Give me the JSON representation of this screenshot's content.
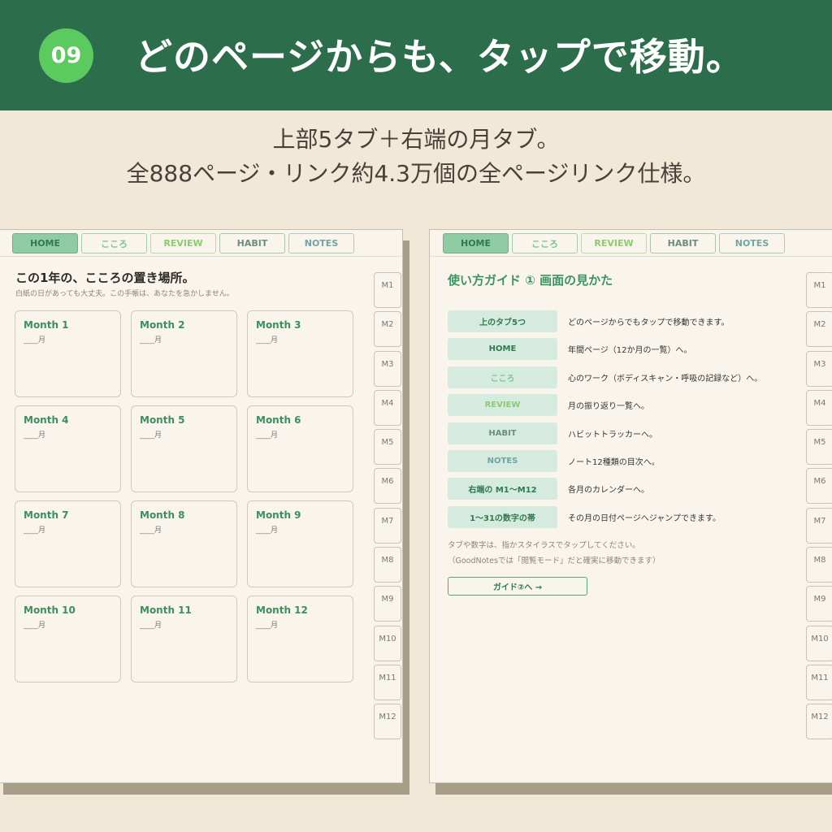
{
  "header": {
    "number": "09",
    "title": "どのページからも、タップで移動。"
  },
  "subtitle": {
    "line1": "上部5タブ＋右端の月タブ。",
    "line2": "全888ページ・リンク約4.3万個の全ページリンク仕様。"
  },
  "tabs": {
    "home": "HOME",
    "kokoro": "こころ",
    "review": "REVIEW",
    "habit": "HABIT",
    "notes": "NOTES"
  },
  "month_tabs": [
    "M1",
    "M2",
    "M3",
    "M4",
    "M5",
    "M6",
    "M7",
    "M8",
    "M9",
    "M10",
    "M11",
    "M12"
  ],
  "colors": {
    "header_bg": "#2c6e4c",
    "badge": "#5ccb5f",
    "background": "#f2e8d8",
    "accent_green": "#3c9460"
  },
  "left_page": {
    "title": "この1年の、こころの置き場所。",
    "subtitle": "白紙の日があっても大丈夫。この手帳は、あなたを急かしません。",
    "months": [
      {
        "label": "Month 1",
        "blank": "____月"
      },
      {
        "label": "Month 2",
        "blank": "____月"
      },
      {
        "label": "Month 3",
        "blank": "____月"
      },
      {
        "label": "Month 4",
        "blank": "____月"
      },
      {
        "label": "Month 5",
        "blank": "____月"
      },
      {
        "label": "Month 6",
        "blank": "____月"
      },
      {
        "label": "Month 7",
        "blank": "____月"
      },
      {
        "label": "Month 8",
        "blank": "____月"
      },
      {
        "label": "Month 9",
        "blank": "____月"
      },
      {
        "label": "Month 10",
        "blank": "____月"
      },
      {
        "label": "Month 11",
        "blank": "____月"
      },
      {
        "label": "Month 12",
        "blank": "____月"
      }
    ]
  },
  "right_page": {
    "title": "使い方ガイド ① 画面の見かた",
    "rows": [
      {
        "chip": "上のタブ5つ",
        "desc": "どのページからでもタップで移動できます。"
      },
      {
        "chip": "HOME",
        "desc": "年間ページ（12か月の一覧）へ。"
      },
      {
        "chip": "こころ",
        "desc": "心のワーク（ボディスキャン・呼吸の記録など）へ。"
      },
      {
        "chip": "REVIEW",
        "desc": "月の振り返り一覧へ。"
      },
      {
        "chip": "HABIT",
        "desc": "ハビットトラッカーへ。"
      },
      {
        "chip": "NOTES",
        "desc": "ノート12種類の目次へ。"
      },
      {
        "chip": "右端の M1〜M12",
        "desc": "各月のカレンダーへ。"
      },
      {
        "chip": "1〜31の数字の帯",
        "desc": "その月の日付ページへジャンプできます。"
      }
    ],
    "note1": "タブや数字は、指かスタイラスでタップしてください。",
    "note2": "（GoodNotesでは「閲覧モード」だと確実に移動できます）",
    "next_button": "ガイド②へ →"
  }
}
